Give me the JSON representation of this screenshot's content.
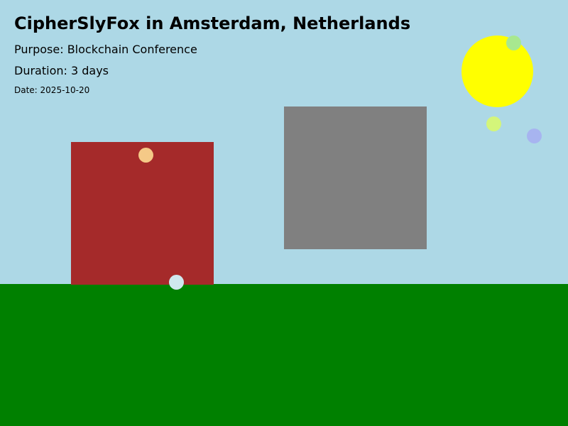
{
  "header": {
    "title": "CipherSlyFox in Amsterdam, Netherlands",
    "purpose": "Purpose: Blockchain Conference",
    "duration": "Duration: 3 days",
    "date": "Date: 2025-10-20"
  },
  "colors": {
    "sky": "#add8e6",
    "ground": "#008000",
    "red_building": "#a52a2a",
    "gray_building": "#808080",
    "sun": "#ffff00",
    "dots": [
      "#f5c987",
      "#cfe8ee",
      "#a8e88f",
      "#d4f57a",
      "#a7b4f0"
    ]
  }
}
